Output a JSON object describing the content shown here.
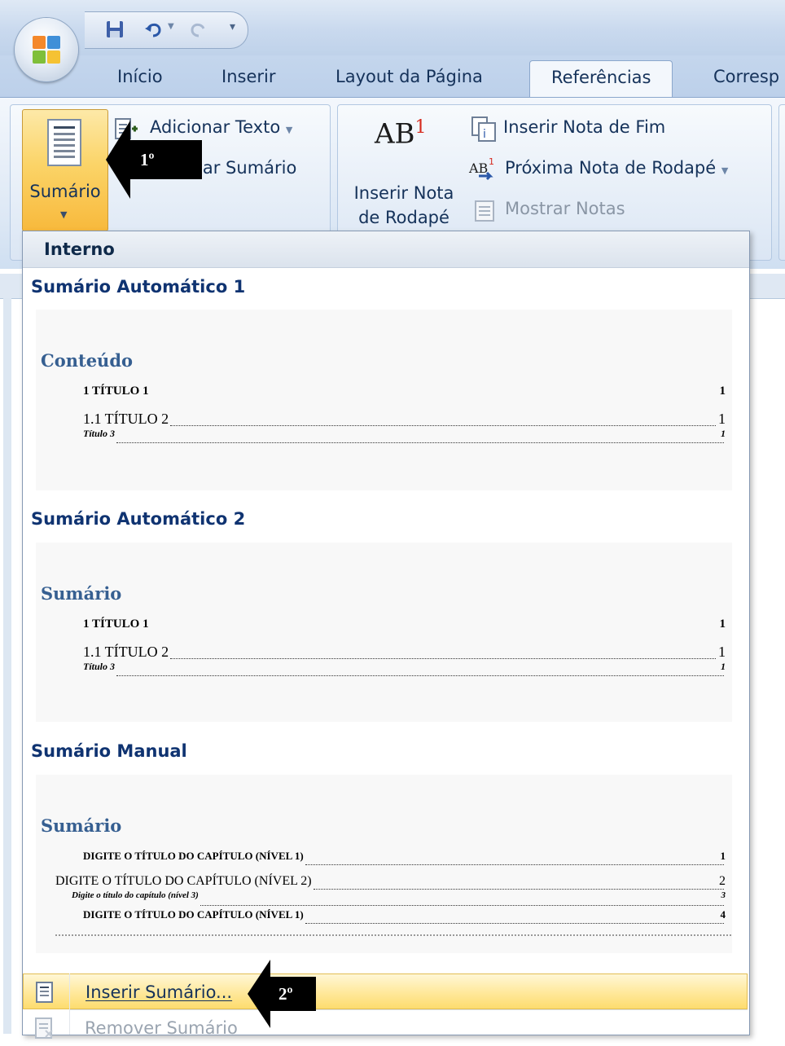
{
  "tabs": [
    {
      "label": "Início",
      "active": false
    },
    {
      "label": "Inserir",
      "active": false
    },
    {
      "label": "Layout da Página",
      "active": false
    },
    {
      "label": "Referências",
      "active": true
    },
    {
      "label": "Corresp",
      "active": false
    }
  ],
  "ribbon": {
    "sumario_group": {
      "sumario_button": "Sumário",
      "adicionar_texto": "Adicionar Texto",
      "atualizar_sumario": "ualizar Sumário"
    },
    "notas_group": {
      "inserir_nota_rodape_line1": "Inserir Nota",
      "inserir_nota_rodape_line2": "de Rodapé",
      "inserir_nota_fim": "Inserir Nota de Fim",
      "proxima_nota": "Próxima Nota de Rodapé",
      "mostrar_notas": "Mostrar Notas",
      "ab_glyph": "AB",
      "ab_sup": "1"
    }
  },
  "dropdown": {
    "header": "Interno",
    "sections": [
      {
        "title": "Sumário Automático 1",
        "preview_heading": "Conteúdo",
        "lines": [
          {
            "label": "1    TÍTULO 1",
            "page": "1",
            "dots": false
          },
          {
            "label": "1.1     TÍTULO 2",
            "page": "1",
            "dots": true
          },
          {
            "label": "Título 3",
            "page": "1",
            "dots": true
          }
        ]
      },
      {
        "title": "Sumário Automático 2",
        "preview_heading": "Sumário",
        "lines": [
          {
            "label": "1    TÍTULO 1",
            "page": "1",
            "dots": false
          },
          {
            "label": "1.1     TÍTULO 2",
            "page": "1",
            "dots": true
          },
          {
            "label": "Título 3",
            "page": "1",
            "dots": true
          }
        ]
      },
      {
        "title": "Sumário Manual",
        "preview_heading": "Sumário",
        "lines": [
          {
            "label": "DIGITE O TÍTULO DO CAPÍTULO (NÍVEL 1)",
            "page": "1"
          },
          {
            "label": "DIGITE O TÍTULO DO CAPÍTULO (NÍVEL 2)",
            "page": "2"
          },
          {
            "label": "Digite o título do capítulo (nível 3)",
            "page": "3"
          },
          {
            "label": "DIGITE O TÍTULO DO CAPÍTULO (NÍVEL 1)",
            "page": "4"
          }
        ]
      }
    ],
    "menu_items": [
      {
        "label": "Inserir Sumário...",
        "highlighted": true,
        "enabled": true
      },
      {
        "label": "Remover Sumário",
        "highlighted": false,
        "enabled": false
      }
    ]
  },
  "callouts": [
    {
      "label": "1º"
    },
    {
      "label": "2º"
    }
  ],
  "colors": {
    "accent_orange": "#f8b93c",
    "heading_blue": "#365f91",
    "section_title_blue": "#0f3371",
    "ribbon_text": "#15325a"
  },
  "icons": [
    "office-logo-icon",
    "save-icon",
    "undo-icon",
    "redo-icon",
    "customize-qat-icon",
    "table-of-contents-icon",
    "add-text-icon",
    "insert-endnote-icon",
    "next-footnote-icon",
    "show-notes-icon",
    "insert-toc-icon",
    "remove-toc-icon"
  ]
}
